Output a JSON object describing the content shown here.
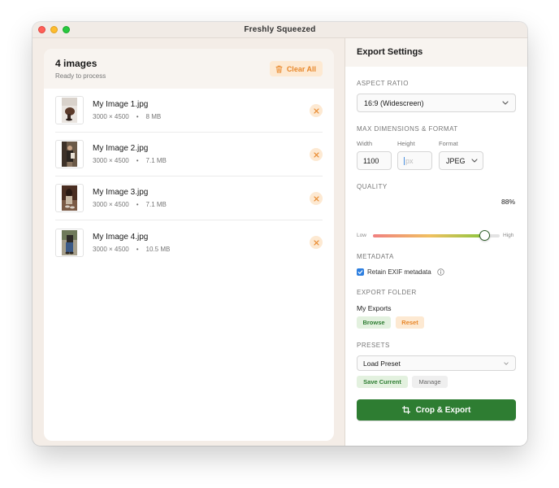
{
  "window": {
    "title": "Freshly Squeezed"
  },
  "left": {
    "count_title": "4 images",
    "subtitle": "Ready to process",
    "clear_label": "Clear All",
    "images": [
      {
        "name": "My Image 1.jpg",
        "dims": "3000 × 4500",
        "sep": "•",
        "size": "8 MB"
      },
      {
        "name": "My Image 2.jpg",
        "dims": "3000 × 4500",
        "sep": "•",
        "size": "7.1 MB"
      },
      {
        "name": "My Image 3.jpg",
        "dims": "3000 × 4500",
        "sep": "•",
        "size": "7.1 MB"
      },
      {
        "name": "My Image 4.jpg",
        "dims": "3000 × 4500",
        "sep": "•",
        "size": "10.5 MB"
      }
    ]
  },
  "settings": {
    "title": "Export Settings",
    "aspect_label": "ASPECT RATIO",
    "aspect_value": "16:9 (Widescreen)",
    "dims_label": "MAX DIMENSIONS & FORMAT",
    "width_label": "Width",
    "width_value": "1100",
    "height_label": "Height",
    "height_placeholder": "px",
    "format_label": "Format",
    "format_value": "JPEG",
    "quality_label": "QUALITY",
    "quality_value": "88%",
    "quality_fraction": 0.88,
    "quality_low": "Low",
    "quality_high": "High",
    "metadata_label": "METADATA",
    "exif_label": "Retain EXIF metadata",
    "exif_checked": true,
    "folder_label": "EXPORT FOLDER",
    "folder_value": "My Exports",
    "browse_label": "Browse",
    "reset_label": "Reset",
    "presets_label": "PRESETS",
    "preset_value": "Load Preset",
    "save_current_label": "Save Current",
    "manage_label": "Manage",
    "export_label": "Crop & Export"
  },
  "colors": {
    "accent_green": "#2e7d32",
    "accent_orange": "#e8872a",
    "checkbox_blue": "#2d7fe0"
  },
  "icons": [
    "trash-icon",
    "close-icon",
    "chevron-down-icon",
    "info-icon",
    "check-icon",
    "crop-icon"
  ]
}
